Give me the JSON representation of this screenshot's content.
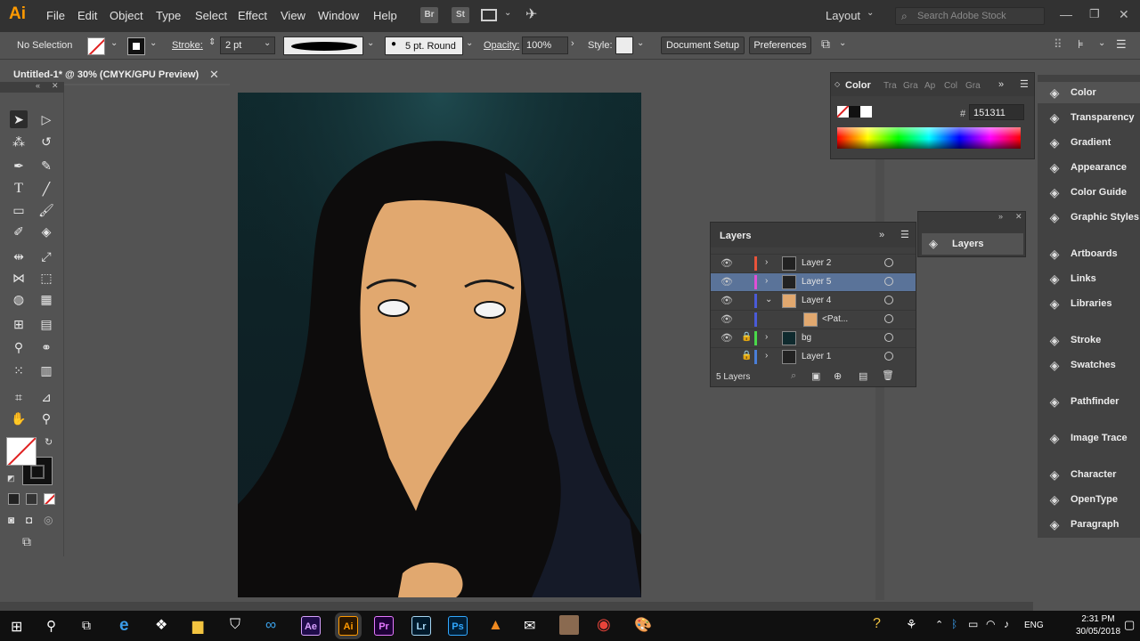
{
  "app": {
    "logo": "Ai",
    "brand_color": "#FF9A00"
  },
  "menu": [
    "File",
    "Edit",
    "Object",
    "Type",
    "Select",
    "Effect",
    "View",
    "Window",
    "Help"
  ],
  "menubar_buttons": {
    "bridge": "Br",
    "stock": "St"
  },
  "workspace": {
    "label": "Layout"
  },
  "search": {
    "placeholder": "Search Adobe Stock"
  },
  "control": {
    "selection_label": "No Selection",
    "stroke_label": "Stroke:",
    "stroke_value": "2 pt",
    "brush_label": "5 pt. Round",
    "opacity_label": "Opacity:",
    "opacity_value": "100%",
    "style_label": "Style:",
    "document_setup": "Document Setup",
    "preferences": "Preferences"
  },
  "document": {
    "tab_title": "Untitled-1* @ 30% (CMYK/GPU Preview)"
  },
  "color_panel": {
    "tabs": [
      "Color",
      "Tra",
      "Gra",
      "Ap",
      "Col",
      "Gra"
    ],
    "hex_value": "151311"
  },
  "layers_panel": {
    "title": "Layers",
    "layers": [
      {
        "name": "Layer 2",
        "color": "#e8533a",
        "expanded": false,
        "locked": false,
        "selected": false,
        "visible": true
      },
      {
        "name": "Layer 5",
        "color": "#e04fd6",
        "expanded": false,
        "locked": false,
        "selected": true,
        "visible": true
      },
      {
        "name": "Layer 4",
        "color": "#4a5bd8",
        "expanded": true,
        "locked": false,
        "selected": false,
        "visible": true
      },
      {
        "name": "<Pat...",
        "color": "#4a5bd8",
        "expanded": false,
        "locked": false,
        "selected": false,
        "visible": true,
        "child": true
      },
      {
        "name": "bg",
        "color": "#4ad84a",
        "expanded": false,
        "locked": true,
        "selected": false,
        "visible": true
      },
      {
        "name": "Layer 1",
        "color": "#4a7ed8",
        "expanded": false,
        "locked": true,
        "selected": false,
        "visible": false
      }
    ],
    "count_label": "5 Layers"
  },
  "layers_mini": {
    "label": "Layers"
  },
  "dock": [
    {
      "label": "Color",
      "icon": "color-icon"
    },
    {
      "label": "Transparency",
      "icon": "transparency-icon"
    },
    {
      "label": "Gradient",
      "icon": "gradient-icon"
    },
    {
      "label": "Appearance",
      "icon": "appearance-icon"
    },
    {
      "label": "Color Guide",
      "icon": "color-guide-icon"
    },
    {
      "label": "Graphic Styles",
      "icon": "graphic-styles-icon"
    },
    {
      "label": "Artboards",
      "icon": "artboards-icon"
    },
    {
      "label": "Links",
      "icon": "links-icon"
    },
    {
      "label": "Libraries",
      "icon": "libraries-icon"
    },
    {
      "label": "Stroke",
      "icon": "stroke-icon"
    },
    {
      "label": "Swatches",
      "icon": "swatches-icon"
    },
    {
      "label": "Pathfinder",
      "icon": "pathfinder-icon"
    },
    {
      "label": "Image Trace",
      "icon": "image-trace-icon"
    },
    {
      "label": "Character",
      "icon": "character-icon"
    },
    {
      "label": "OpenType",
      "icon": "opentype-icon"
    },
    {
      "label": "Paragraph",
      "icon": "paragraph-icon"
    }
  ],
  "taskbar": {
    "apps": [
      {
        "label": "Ae",
        "bg": "#1f0c4a",
        "fg": "#d8a1ff"
      },
      {
        "label": "Ai",
        "bg": "#2a1600",
        "fg": "#ff9a00"
      },
      {
        "label": "Pr",
        "bg": "#1e0038",
        "fg": "#e579ff"
      },
      {
        "label": "Lr",
        "bg": "#001a2c",
        "fg": "#a6d6f3"
      },
      {
        "label": "Ps",
        "bg": "#001e36",
        "fg": "#31a8ff"
      }
    ],
    "lang": "ENG",
    "time": "2:31 PM",
    "date": "30/05/2018"
  }
}
